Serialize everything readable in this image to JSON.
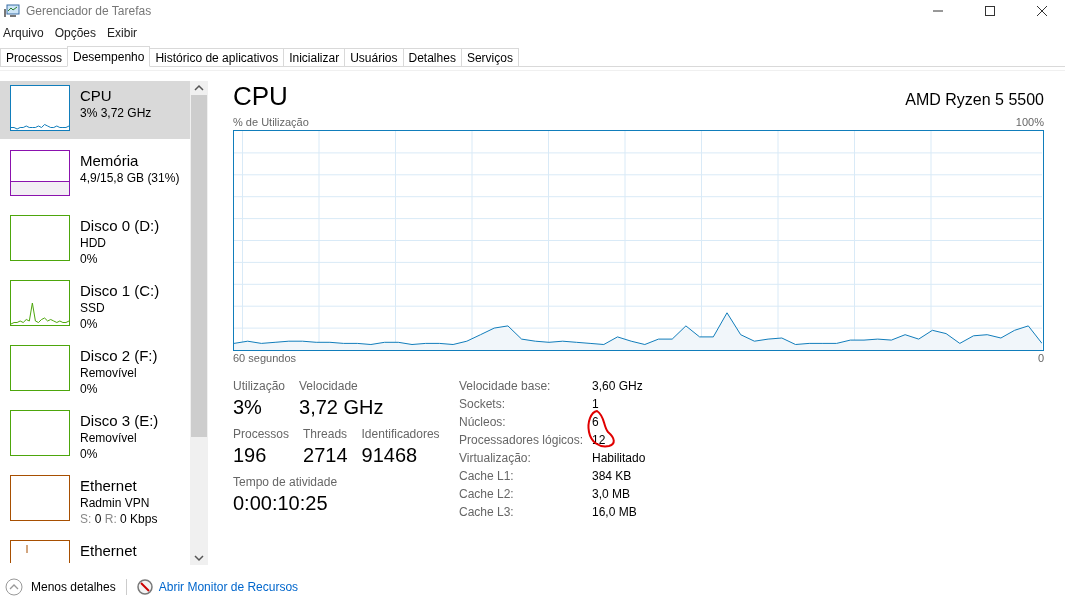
{
  "window": {
    "title": "Gerenciador de Tarefas"
  },
  "menu": [
    "Arquivo",
    "Opções",
    "Exibir"
  ],
  "tabs": [
    {
      "label": "Processos",
      "selected": false
    },
    {
      "label": "Desempenho",
      "selected": true
    },
    {
      "label": "Histórico de aplicativos",
      "selected": false
    },
    {
      "label": "Inicializar",
      "selected": false
    },
    {
      "label": "Usuários",
      "selected": false
    },
    {
      "label": "Detalhes",
      "selected": false
    },
    {
      "label": "Serviços",
      "selected": false
    }
  ],
  "sidebar": {
    "items": [
      {
        "kind": "cpu",
        "name": "CPU",
        "lines": [
          "3% 3,72 GHz"
        ],
        "color": "#117dbb",
        "selected": true,
        "sparkline": true
      },
      {
        "kind": "memory",
        "name": "Memória",
        "lines": [
          "4,9/15,8 GB (31%)"
        ],
        "color": "#8b12ae",
        "selected": false
      },
      {
        "kind": "disk",
        "name": "Disco 0 (D:)",
        "lines": [
          "HDD",
          "0%"
        ],
        "color": "#4da60c",
        "selected": false,
        "sparkline": false
      },
      {
        "kind": "disk",
        "name": "Disco 1 (C:)",
        "lines": [
          "SSD",
          "0%"
        ],
        "color": "#4da60c",
        "selected": false,
        "sparkline": true
      },
      {
        "kind": "disk",
        "name": "Disco 2 (F:)",
        "lines": [
          "Removível",
          "0%"
        ],
        "color": "#4da60c",
        "selected": false,
        "sparkline": false
      },
      {
        "kind": "disk",
        "name": "Disco 3 (E:)",
        "lines": [
          "Removível",
          "0%"
        ],
        "color": "#4da60c",
        "selected": false,
        "sparkline": false
      },
      {
        "kind": "network",
        "name": "Ethernet",
        "lines": [
          "Radmin VPN"
        ],
        "stats": [
          {
            "label": "S:",
            "value": "0"
          },
          {
            "label": "R:",
            "value": "0 Kbps"
          }
        ],
        "color": "#a74f01",
        "selected": false,
        "sparkline": false
      },
      {
        "kind": "network",
        "name": "Ethernet",
        "color": "#a74f01",
        "selected": false,
        "sparkline": true
      }
    ]
  },
  "main": {
    "title": "CPU",
    "model": "AMD Ryzen 5 5500",
    "y_max_label": "100%",
    "x_start_label": "60 segundos",
    "x_end_label": "0",
    "y_label": "% de Utilização",
    "stats": [
      [
        {
          "label": "Utilização",
          "value": "3%"
        },
        {
          "label": "Velocidade",
          "value": "3,72 GHz"
        }
      ],
      [
        {
          "label": "Processos",
          "value": "196"
        },
        {
          "label": "Threads",
          "value": "2714"
        },
        {
          "label": "Identificadores",
          "value": "91468"
        }
      ],
      [
        {
          "label": "Tempo de atividade",
          "value": "0:00:10:25"
        }
      ]
    ],
    "details": [
      {
        "label": "Velocidade base:",
        "value": "3,60 GHz"
      },
      {
        "label": "Sockets:",
        "value": "1"
      },
      {
        "label": "Núcleos:",
        "value": "6"
      },
      {
        "label": "Processadores lógicos:",
        "value": "12"
      },
      {
        "label": "Virtualização:",
        "value": "Habilitado"
      },
      {
        "label": "Cache L1:",
        "value": "384 KB"
      },
      {
        "label": "Cache L2:",
        "value": "3,0 MB"
      },
      {
        "label": "Cache L3:",
        "value": "16,0 MB"
      }
    ]
  },
  "footer": {
    "less_details": "Menos detalhes",
    "monitor_link": "Abrir Monitor de Recursos"
  }
}
